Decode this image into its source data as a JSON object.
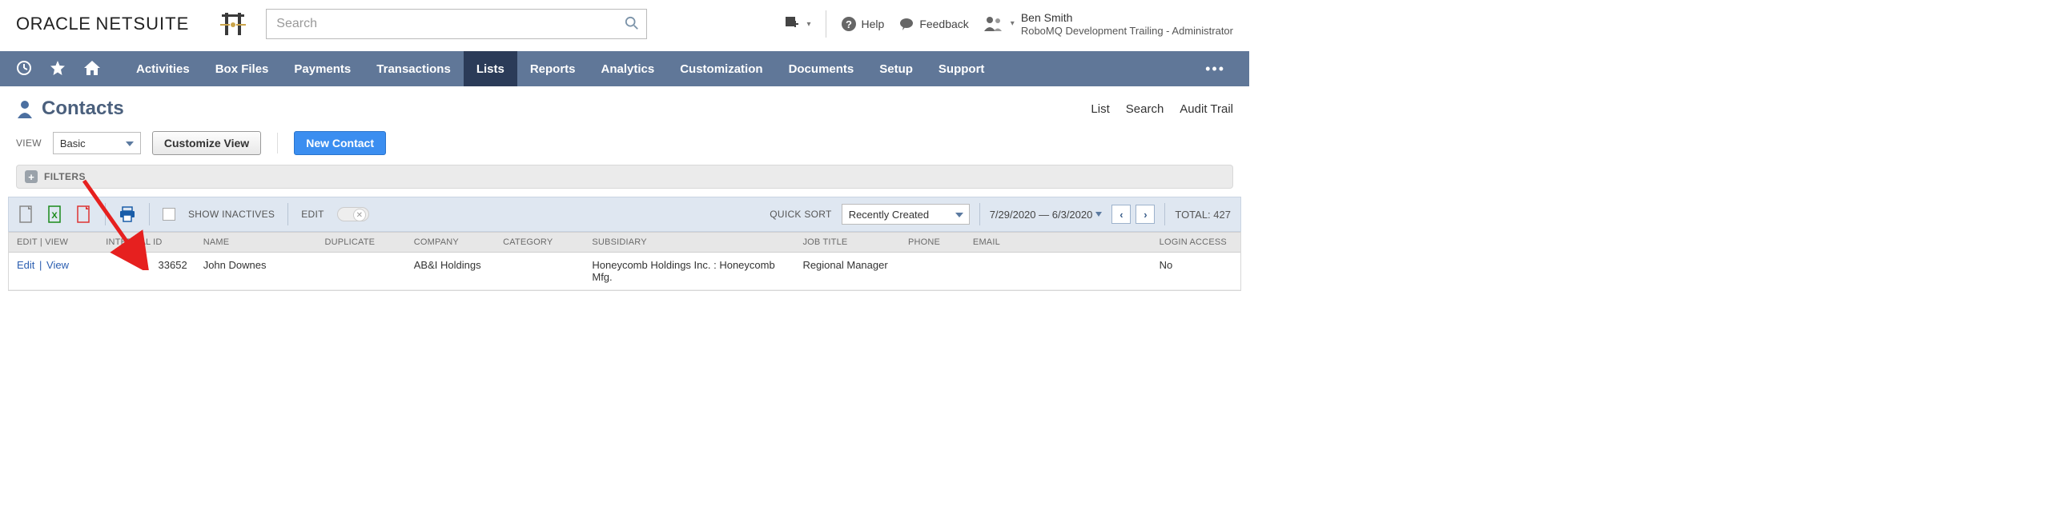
{
  "header": {
    "logo1": "ORACLE",
    "logo2": "NETSUITE",
    "search_placeholder": "Search",
    "help_label": "Help",
    "feedback_label": "Feedback",
    "user_name": "Ben Smith",
    "user_role": "RoboMQ Development Trailing - Administrator"
  },
  "nav": {
    "items": [
      "Activities",
      "Box Files",
      "Payments",
      "Transactions",
      "Lists",
      "Reports",
      "Analytics",
      "Customization",
      "Documents",
      "Setup",
      "Support"
    ],
    "active": "Lists"
  },
  "page": {
    "title": "Contacts",
    "head_actions": [
      "List",
      "Search",
      "Audit Trail"
    ]
  },
  "viewrow": {
    "view_label": "VIEW",
    "view_value": "Basic",
    "customize_label": "Customize View",
    "new_label": "New Contact"
  },
  "filters": {
    "label": "FILTERS"
  },
  "toolbar": {
    "show_inactives": "SHOW INACTIVES",
    "edit": "EDIT",
    "quicksort_label": "QUICK SORT",
    "quicksort_value": "Recently Created",
    "daterange": "7/29/2020 — 6/3/2020",
    "total_label": "TOTAL:",
    "total_value": "427"
  },
  "table": {
    "columns": [
      "EDIT | VIEW",
      "INTERNAL ID",
      "NAME",
      "DUPLICATE",
      "COMPANY",
      "CATEGORY",
      "SUBSIDIARY",
      "JOB TITLE",
      "PHONE",
      "EMAIL",
      "LOGIN ACCESS"
    ],
    "rows": [
      {
        "edit": "Edit",
        "view": "View",
        "internal_id": "33652",
        "name": "John Downes",
        "duplicate": "",
        "company": "AB&I Holdings",
        "category": "",
        "subsidiary": "Honeycomb Holdings Inc. : Honeycomb Mfg.",
        "job_title": "Regional Manager",
        "phone": "",
        "email": "",
        "login_access": "No"
      }
    ]
  }
}
